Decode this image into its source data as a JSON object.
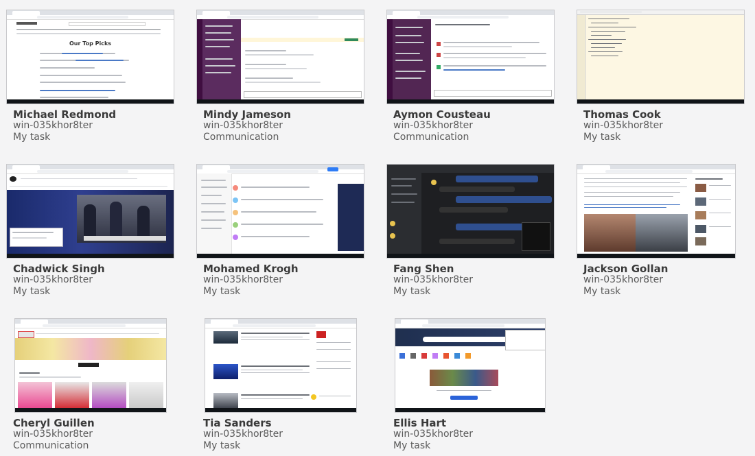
{
  "sessions": [
    {
      "name": "Michael Redmond",
      "host": "win-035khor8ter",
      "group": "My task"
    },
    {
      "name": "Mindy Jameson",
      "host": "win-035khor8ter",
      "group": "Communication"
    },
    {
      "name": "Aymon Cousteau",
      "host": "win-035khor8ter",
      "group": "Communication"
    },
    {
      "name": "Thomas Cook",
      "host": "win-035khor8ter",
      "group": "My task"
    },
    {
      "name": "Chadwick Singh",
      "host": "win-035khor8ter",
      "group": "My task"
    },
    {
      "name": "Mohamed Krogh",
      "host": "win-035khor8ter",
      "group": "My task"
    },
    {
      "name": "Fang Shen",
      "host": "win-035khor8ter",
      "group": "My task"
    },
    {
      "name": "Jackson Gollan",
      "host": "win-035khor8ter",
      "group": "My task"
    },
    {
      "name": "Cheryl Guillen",
      "host": "win-035khor8ter",
      "group": "Communication"
    },
    {
      "name": "Tia Sanders",
      "host": "win-035khor8ter",
      "group": "My task"
    },
    {
      "name": "Ellis Hart",
      "host": "win-035khor8ter",
      "group": "My task"
    }
  ],
  "thumb_text": {
    "top_picks_heading": "Our Top Picks"
  }
}
